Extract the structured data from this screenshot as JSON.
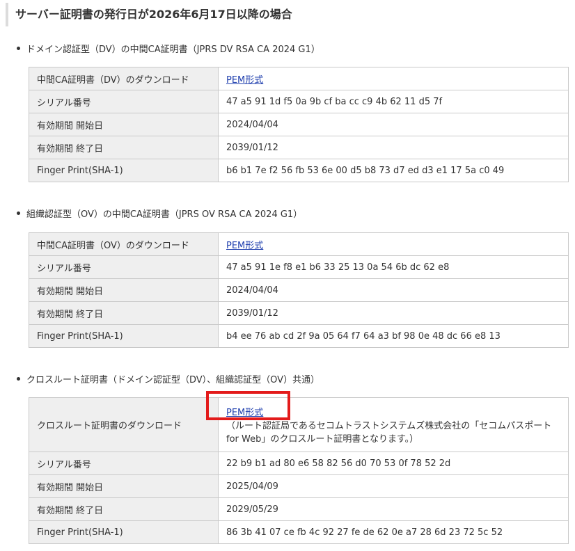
{
  "page": {
    "heading": "サーバー証明書の発行日が2026年6月17日以降の場合"
  },
  "sections": [
    {
      "title": "ドメイン認証型（DV）の中間CA証明書（JPRS DV RSA CA 2024 G1）",
      "rows": {
        "download_key": "中間CA証明書（DV）のダウンロード",
        "download_link": "PEM形式",
        "serial_key": "シリアル番号",
        "serial_val": "47 a5 91 1d f5 0a 9b cf ba cc c9 4b 62 11 d5 7f",
        "start_key": "有効期間 開始日",
        "start_val": "2024/04/04",
        "end_key": "有効期間 終了日",
        "end_val": "2039/01/12",
        "fp_key": "Finger Print(SHA-1)",
        "fp_val": "b6 b1 7e f2 56 fb 53 6e 00 d5 b8 73 d7 ed d3 e1 17 5a c0 49"
      }
    },
    {
      "title": "組織認証型（OV）の中間CA証明書（JPRS OV RSA CA 2024 G1）",
      "rows": {
        "download_key": "中間CA証明書（OV）のダウンロード",
        "download_link": "PEM形式",
        "serial_key": "シリアル番号",
        "serial_val": "47 a5 91 1e f8 e1 b6 33 25 13 0a 54 6b dc 62 e8",
        "start_key": "有効期間 開始日",
        "start_val": "2024/04/04",
        "end_key": "有効期間 終了日",
        "end_val": "2039/01/12",
        "fp_key": "Finger Print(SHA-1)",
        "fp_val": "b4 ee 76 ab cd 2f 9a 05 64 f7 64 a3 bf 98 0e 48 dc 66 e8 13"
      }
    },
    {
      "title": "クロスルート証明書（ドメイン認証型（DV）、組織認証型（OV）共通）",
      "rows": {
        "download_key": "クロスルート証明書のダウンロード",
        "download_link": "PEM形式",
        "download_note": "（ルート認証局であるセコムトラストシステムズ株式会社の「セコムパスポート for Web」のクロスルート証明書となります。）",
        "serial_key": "シリアル番号",
        "serial_val": "22 b9 b1 ad 80 e6 58 82 56 d0 70 53 0f 78 52 2d",
        "start_key": "有効期間 開始日",
        "start_val": "2025/04/09",
        "end_key": "有効期間 終了日",
        "end_val": "2029/05/29",
        "fp_key": "Finger Print(SHA-1)",
        "fp_val": "86 3b 41 07 ce fb 4c 92 27 fe de 62 0e a7 28 6d 23 72 5c 52"
      }
    }
  ],
  "colors": {
    "highlight_box": "#e31b1b",
    "key_cell_bg": "#efefef",
    "link": "#1f3fae"
  }
}
